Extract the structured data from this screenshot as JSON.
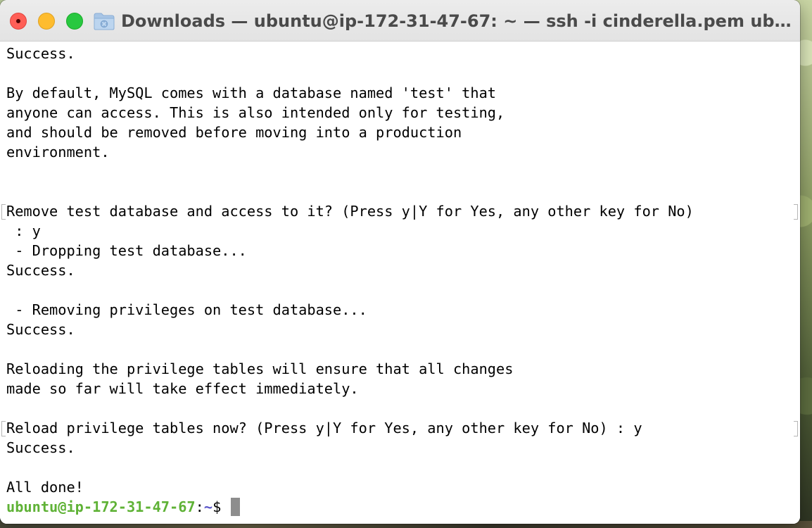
{
  "window": {
    "title": "Downloads — ubuntu@ip-172-31-47-67: ~ — ssh -i cinderella.pem ubuntu..."
  },
  "icons": {
    "folder": "folder-icon",
    "close": "close-icon",
    "minimize": "minimize-icon",
    "zoom": "zoom-icon"
  },
  "colors": {
    "close": "#ff5f57",
    "minimize": "#febc2e",
    "zoom": "#28c840",
    "prompt_user": "#5fb236",
    "prompt_path": "#5a55c9",
    "cursor": "#8d8d8d"
  },
  "terminal": {
    "lines": [
      "Success.",
      "",
      "By default, MySQL comes with a database named 'test' that",
      "anyone can access. This is also intended only for testing,",
      "and should be removed before moving into a production",
      "environment.",
      "",
      "",
      "Remove test database and access to it? (Press y|Y for Yes, any other key for No)",
      " : y",
      " - Dropping test database...",
      "Success.",
      "",
      " - Removing privileges on test database...",
      "Success.",
      "",
      "Reloading the privilege tables will ensure that all changes",
      "made so far will take effect immediately.",
      "",
      "Reload privilege tables now? (Press y|Y for Yes, any other key for No) : y",
      "Success.",
      "",
      "All done!"
    ],
    "prompt": {
      "user_host": "ubuntu@ip-172-31-47-67",
      "colon": ":",
      "path": "~",
      "symbol": "$ "
    }
  }
}
